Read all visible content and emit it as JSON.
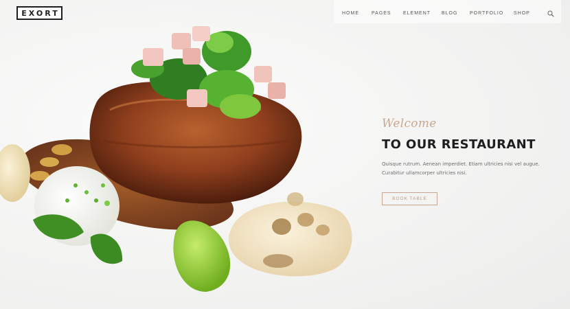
{
  "logo": {
    "text": "EXORT"
  },
  "nav": {
    "items": [
      "HOME",
      "PAGES",
      "ELEMENT",
      "BLOG",
      "PORTFOLIO",
      "SHOP"
    ],
    "search_icon": "search-icon"
  },
  "hero": {
    "welcome": "Welcome",
    "title": "TO OUR RESTAURANT",
    "description_lines": [
      "Quisque rutrum. Aenean imperdiet. Etiam ultricies nisi vel augue.",
      "Curabitur ullamcorper ultricies nisi."
    ],
    "button_label": "BOOK TABLE"
  },
  "colors": {
    "accent": "#c8a98f",
    "heading": "#1e1e1e",
    "text": "#6d6d6d",
    "background": "#f4f4f3"
  }
}
